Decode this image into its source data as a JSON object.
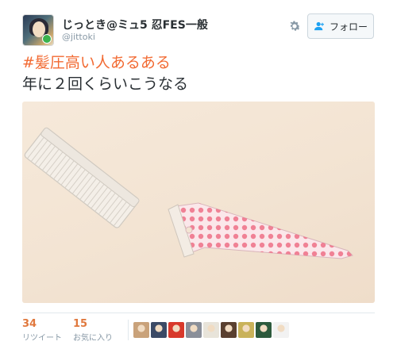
{
  "user": {
    "display_name": "じっとき@ミュ5 忍FES一般",
    "handle": "@jittoki"
  },
  "actions": {
    "follow_label": "フォロー",
    "settings_icon": "gear-icon",
    "follow_icon": "add-user-icon"
  },
  "tweet": {
    "hashtag": "#髪圧高い人あるある",
    "text": "年に２回くらいこうなる",
    "hashtag_color": "#f26a32"
  },
  "stats": {
    "retweets": "34",
    "retweets_label": "リツイート",
    "likes": "15",
    "likes_label": "お気に入り",
    "count_color": "#e0783d"
  },
  "likers": [
    {
      "name": "liker-avatar-1",
      "color": "#c9a27a"
    },
    {
      "name": "liker-avatar-2",
      "color": "#3b4a66"
    },
    {
      "name": "liker-avatar-3",
      "color": "#d8392b"
    },
    {
      "name": "liker-avatar-4",
      "color": "#8a8f99"
    },
    {
      "name": "liker-avatar-5",
      "color": "#e8e4da"
    },
    {
      "name": "liker-avatar-6",
      "color": "#5a4030"
    },
    {
      "name": "liker-avatar-7",
      "color": "#c9b25a"
    },
    {
      "name": "liker-avatar-8",
      "color": "#2d5a3d"
    },
    {
      "name": "liker-avatar-9",
      "color": "#f2f2f2"
    }
  ]
}
